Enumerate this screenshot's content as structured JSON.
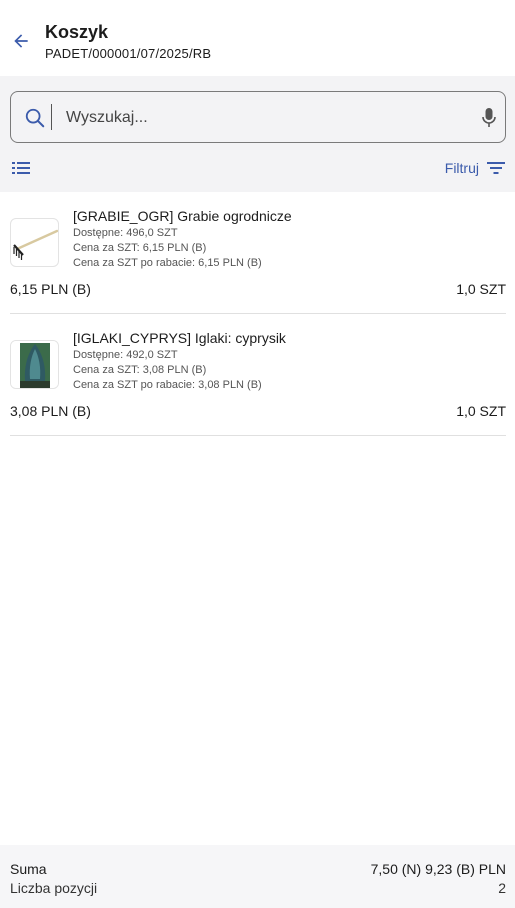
{
  "header": {
    "title": "Koszyk",
    "subtitle": "PADET/000001/07/2025/RB",
    "accent_color": "#3b5bab"
  },
  "search": {
    "placeholder": "Wyszukaj...",
    "value": ""
  },
  "toolbar": {
    "filter_label": "Filtruj"
  },
  "items": [
    {
      "name": "[GRABIE_OGR] Grabie ogrodnicze",
      "available": "Dostępne: 496,0 SZT",
      "unit_price": "Cena za SZT: 6,15 PLN (B)",
      "discount_price": "Cena za SZT po rabacie: 6,15 PLN (B)",
      "total": "6,15 PLN (B)",
      "qty": "1,0 SZT",
      "thumb_icon": "rake-image"
    },
    {
      "name": "[IGLAKI_CYPRYS] Iglaki: cyprysik",
      "available": "Dostępne: 492,0 SZT",
      "unit_price": "Cena za SZT: 3,08 PLN (B)",
      "discount_price": "Cena za SZT po rabacie: 3,08 PLN (B)",
      "total": "3,08 PLN (B)",
      "qty": "1,0 SZT",
      "thumb_icon": "cypress-image"
    }
  ],
  "footer": {
    "sum_label": "Suma",
    "sum_value": "7,50 (N) 9,23 (B) PLN",
    "count_label": "Liczba pozycji",
    "count_value": "2"
  }
}
